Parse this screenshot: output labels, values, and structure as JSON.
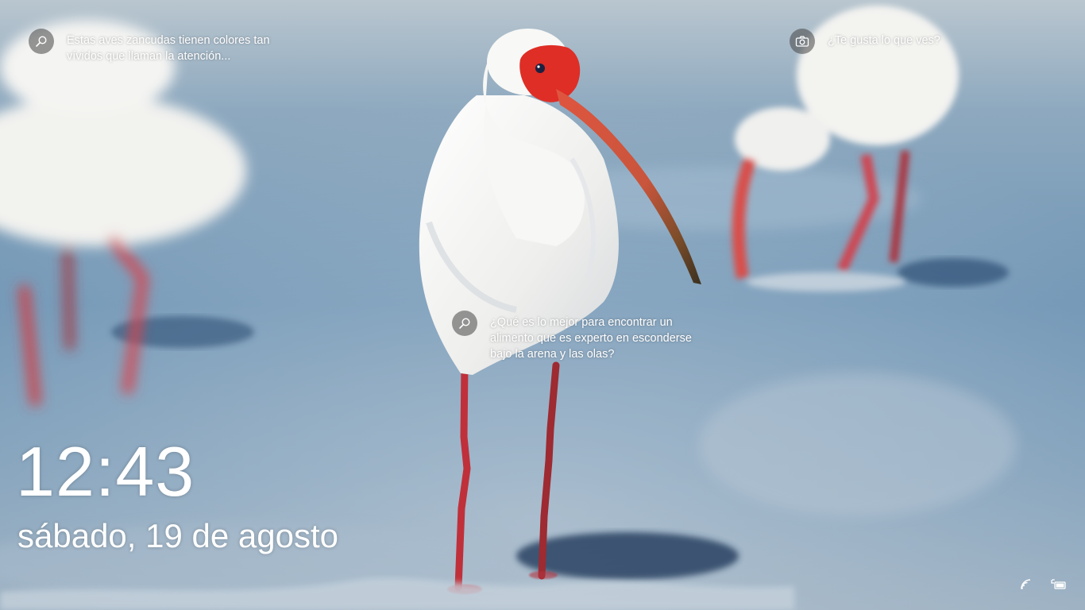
{
  "screen": "windows-lock-screen",
  "wallpaper": {
    "subject": "white ibises wading at the shoreline",
    "colors": {
      "water": "#6f95b5",
      "sand": "#b9c7d3",
      "bird_white": "#f3f3f0",
      "beak_red": "#d9402f",
      "legs_red": "#c0303a"
    }
  },
  "hotspots": [
    {
      "icon": "search-icon",
      "text": "Estas aves zancudas tienen colores tan\nvívidos que llaman la atención..."
    },
    {
      "icon": "camera-icon",
      "text": "¿Te gusta lo que ves?"
    },
    {
      "icon": "search-icon",
      "text": "¿Qué es lo mejor para encontrar un\nalimento que es experto en esconderse\nbajo la arena y las olas?"
    }
  ],
  "clock": {
    "time": "12:43",
    "date": "sábado, 19 de agosto"
  },
  "tray": [
    {
      "icon": "wifi-icon"
    },
    {
      "icon": "battery-plugged-icon"
    }
  ]
}
